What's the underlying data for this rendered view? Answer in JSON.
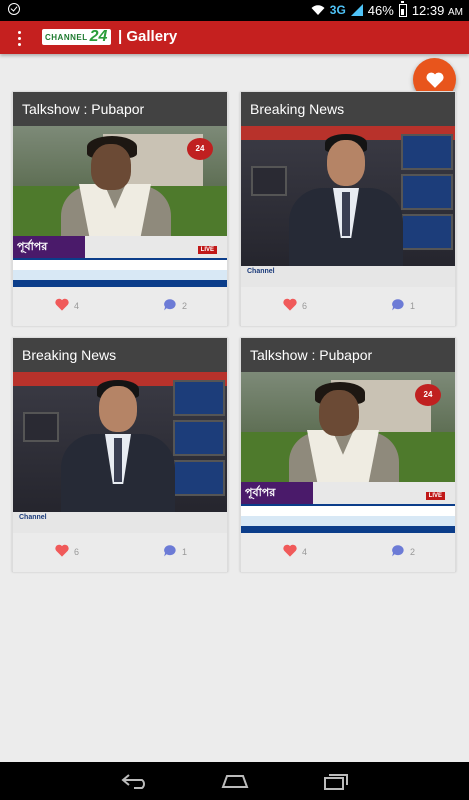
{
  "status_bar": {
    "network": "3G",
    "battery": "46%",
    "time": "12:39",
    "time_suffix": "AM"
  },
  "app_bar": {
    "logo_text": "CHANNEL",
    "logo_number": "24",
    "title": "| Gallery"
  },
  "colors": {
    "app_bar": "#c5201f",
    "fab": "#e8551c",
    "like_heart": "#f05a5a",
    "comment_bubble": "#6c7bd6"
  },
  "cards": [
    {
      "title": "Talkshow : Pubapor",
      "thumb": "talkshow",
      "likes": "4",
      "comments": "2",
      "thumb_texts": {
        "logo": "24",
        "caption": "পূর্বাপর",
        "live": "LIVE"
      }
    },
    {
      "title": "Breaking News",
      "thumb": "news",
      "likes": "6",
      "comments": "1",
      "thumb_texts": {
        "channel": "Channel"
      }
    },
    {
      "title": "Breaking News",
      "thumb": "news",
      "likes": "6",
      "comments": "1",
      "thumb_texts": {
        "channel": "Channel"
      }
    },
    {
      "title": "Talkshow : Pubapor",
      "thumb": "talkshow",
      "likes": "4",
      "comments": "2",
      "thumb_texts": {
        "logo": "24",
        "caption": "পূর্বাপর",
        "live": "LIVE"
      }
    }
  ],
  "icons": {
    "fab": "heart-icon",
    "like": "heart-icon",
    "comment": "comment-bubble-icon",
    "nav": [
      "back-icon",
      "home-icon",
      "recent-apps-icon"
    ]
  }
}
